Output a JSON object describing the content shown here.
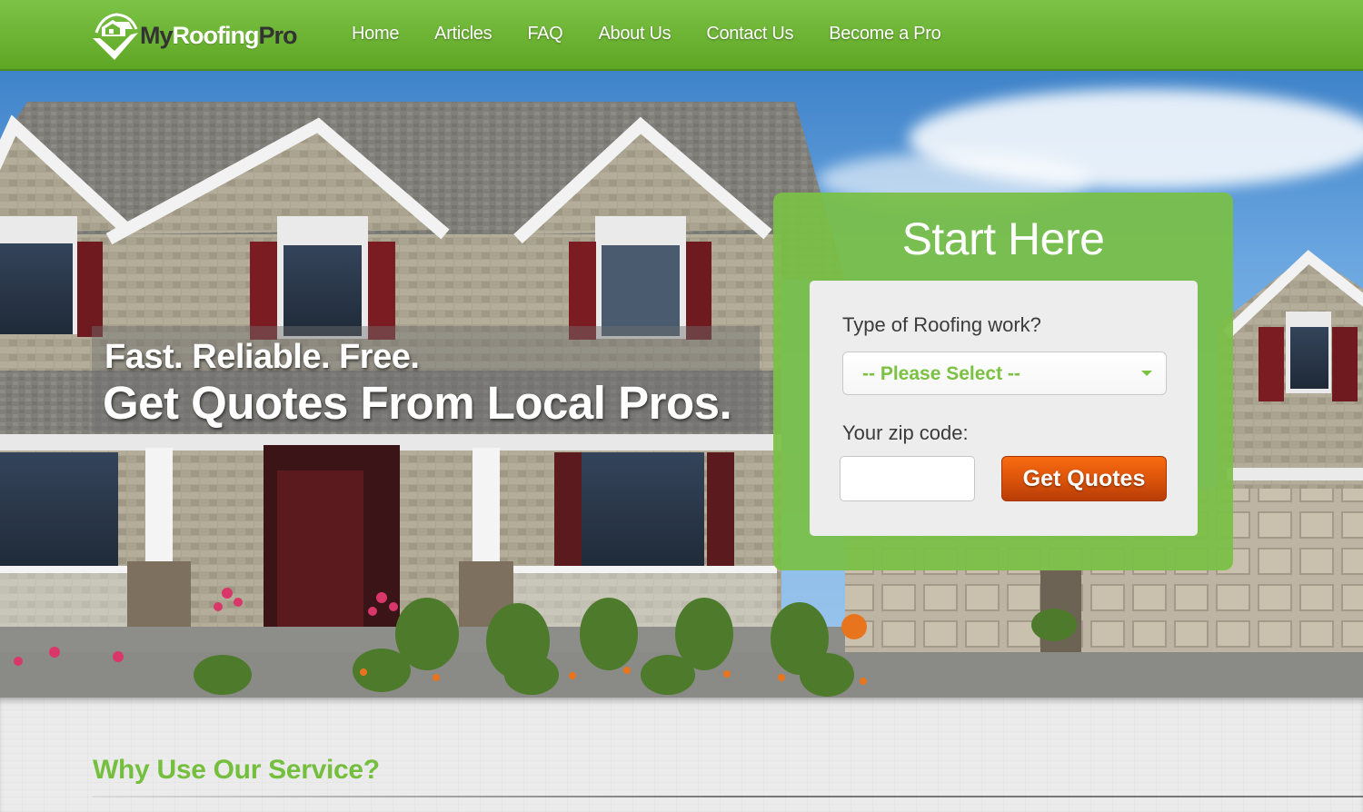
{
  "brand": {
    "name_part1": "My",
    "name_part2": "Roofing",
    "name_part3": "Pro",
    "primary_color": "#6db536",
    "accent_color": "#e0580b"
  },
  "nav": {
    "items": [
      {
        "label": "Home"
      },
      {
        "label": "Articles"
      },
      {
        "label": "FAQ"
      },
      {
        "label": "About Us"
      },
      {
        "label": "Contact Us"
      },
      {
        "label": "Become a Pro"
      }
    ]
  },
  "hero": {
    "tagline_line1": "Fast. Reliable. Free.",
    "tagline_line2": "Get Quotes From Local Pros."
  },
  "form": {
    "title": "Start Here",
    "type_label": "Type of Roofing work?",
    "type_selected": "-- Please Select --",
    "zip_label": "Your zip code:",
    "zip_value": "",
    "submit_label": "Get Quotes"
  },
  "section": {
    "title": "Why Use Our Service?"
  }
}
